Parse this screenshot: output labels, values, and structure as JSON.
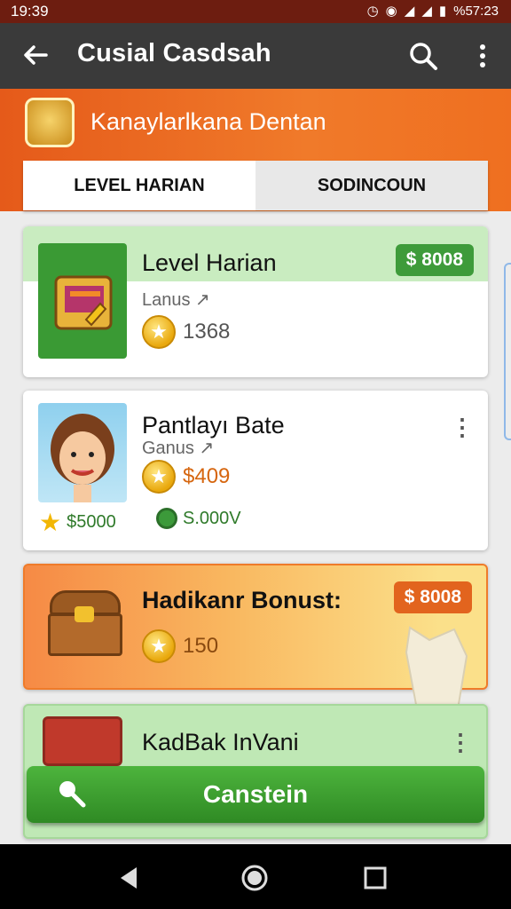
{
  "status_bar": {
    "time": "19:39",
    "right_time": "%57:23"
  },
  "app_bar": {
    "title": "Cusial Casdsah"
  },
  "shop": {
    "name": "Kanaylarlkana Dentan"
  },
  "tabs": [
    {
      "label": "LEVEL HARIAN",
      "active": true
    },
    {
      "label": "SODINCOUN",
      "active": false
    }
  ],
  "cards": [
    {
      "title": "Level Harian",
      "subtitle": "Lanus ↗",
      "coin_value": "1368",
      "price": "$ 8008"
    },
    {
      "title": "Pantlayı Bate",
      "subtitle": "Ganus ↗",
      "coin_value": "$409",
      "stat_star_value": "$5000",
      "stat_green_value": "S.000V"
    },
    {
      "title": "Hadikanr Bonust:",
      "coin_value": "150",
      "price": "$ 8008"
    },
    {
      "title": "KadBak InVani"
    }
  ],
  "cta": {
    "label": "Canstein"
  },
  "colors": {
    "status_bar": "#6d1d10",
    "app_bar": "#3a3a3a",
    "orange_accent": "#e55a1a",
    "green_accent": "#3e9b3a"
  },
  "icons": {
    "back": "arrow-left-icon",
    "search": "search-icon",
    "more": "kebab-menu-icon",
    "coin": "star-coin-icon"
  }
}
